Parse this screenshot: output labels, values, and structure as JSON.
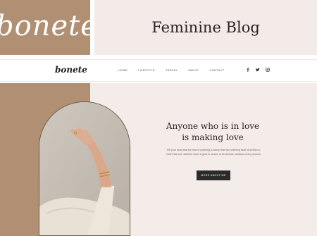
{
  "banner": {
    "brand_script": "bonete",
    "hero_title": "Feminine Blog"
  },
  "nav": {
    "logo": "bonete",
    "links": [
      "Home",
      "Lifestyle",
      "Travel",
      "About",
      "Contact"
    ],
    "social_icons": [
      "facebook-icon",
      "twitter-icon",
      "instagram-icon"
    ]
  },
  "hero": {
    "headline_line1": "Anyone who is in love",
    "headline_line2": "is making love",
    "paragraph": "Tell your heart that the fear of suffering is worse than the suffering itself. And that no heart has ever suffered when it goes in search of its dreams, because every second",
    "cta_label": "More about me"
  },
  "colors": {
    "brand_brown": "#b18f73",
    "soft_pink": "#f3ece8",
    "dark": "#2b2b2b"
  }
}
